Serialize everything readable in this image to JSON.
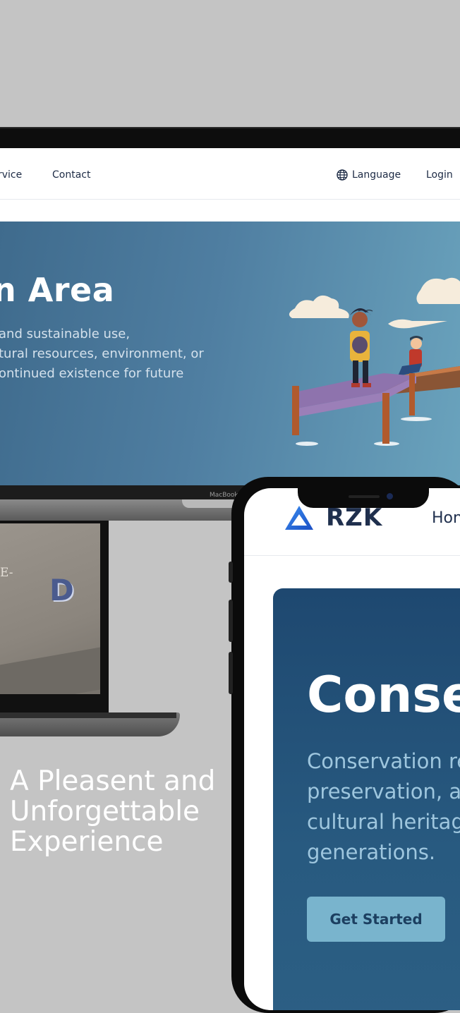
{
  "laptop_site": {
    "nav": {
      "service": "rvice",
      "contact": "Contact",
      "language": "Language",
      "login": "Login"
    },
    "hero": {
      "title": "n Area",
      "description": [
        "and sustainable use,",
        "tural resources, environment, or",
        "ontinued existence for future"
      ]
    },
    "device_label": "MacBook"
  },
  "laptop2": {
    "letter_e": "E-",
    "letter_d": "D"
  },
  "tagline": [
    "A Pleasent and",
    "Unforgettable",
    "Experience"
  ],
  "phone_site": {
    "logo_text": "RZK",
    "nav_home": "Hon",
    "hero": {
      "title": "Conse",
      "description": [
        "Conservation re",
        "preservation, an",
        "cultural heritage",
        "generations."
      ],
      "cta": "Get Started"
    }
  },
  "colors": {
    "background": "#c4c4c4",
    "hero_gradient_start": "#3f6b8d",
    "hero_gradient_end": "#6aa3bd",
    "phone_hero": "#1e4870",
    "cta_button": "#79b4cd",
    "brand_text": "#1f2f4d",
    "logo_blue": "#2166d8"
  }
}
